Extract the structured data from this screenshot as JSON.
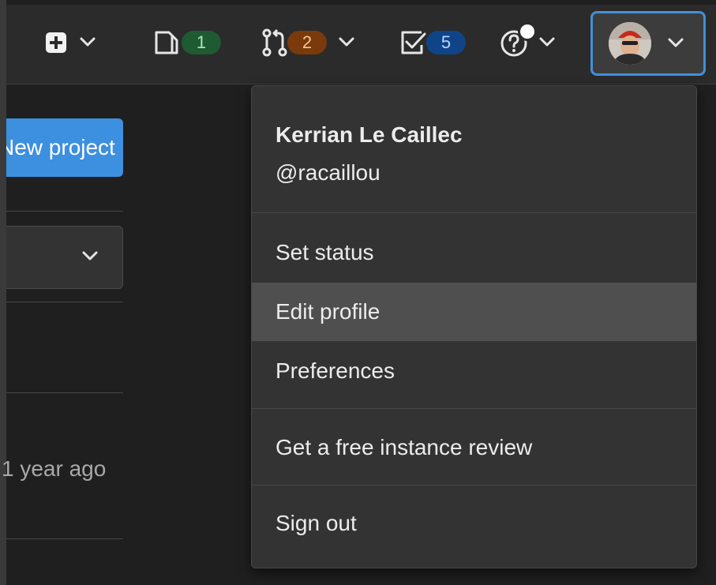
{
  "navbar": {
    "issues_count": "1",
    "merge_requests_count": "2",
    "todos_count": "5"
  },
  "page": {
    "new_project_label": "New project",
    "timestamp": "1 year ago"
  },
  "user_menu": {
    "name": "Kerrian Le Caillec",
    "handle": "@racaillou",
    "items": [
      {
        "label": "Set status"
      },
      {
        "label": "Edit profile",
        "highlighted": true
      },
      {
        "label": "Preferences"
      },
      {
        "label": "Get a free instance review"
      },
      {
        "label": "Sign out"
      }
    ]
  },
  "icons": {
    "new": "plus-square-icon",
    "issues": "issues-icon",
    "merge_requests": "merge-request-icon",
    "todos": "todo-checkbox-icon",
    "help": "question-circle-icon",
    "caret": "chevron-down-icon"
  },
  "colors": {
    "accent_blue": "#428fdc",
    "issues_badge": "#1e5a32",
    "mr_badge": "#7a3a0c",
    "todo_badge": "#0f4588",
    "menu_bg": "#333333",
    "menu_highlight": "#4f4f4f"
  }
}
